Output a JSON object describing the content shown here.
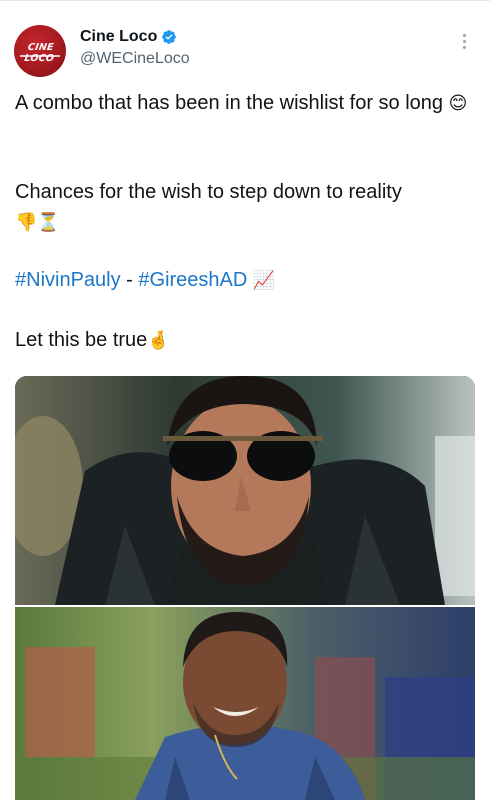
{
  "tweet": {
    "display_name": "Cine Loco",
    "handle": "@WECineLoco",
    "avatar_text": "CINE LOCO",
    "line1": "A combo that has been in the wishlist for so long",
    "line1_emoji": "😊",
    "line2": "Chances for the wish to step down to reality",
    "line2_emojis": "👎⏳",
    "hashtag1": "#NivinPauly",
    "separator": " - ",
    "hashtag2": "#GireeshAD",
    "hashtag_emoji": "📈",
    "line4": "Let this be true",
    "line4_emoji": "🤞"
  },
  "colors": {
    "hashtag": "#1d77c8",
    "verified_badge": "#1d9bf0",
    "handle": "#536471",
    "avatar": "#a51a20"
  },
  "icons": [
    "verified-badge-icon",
    "more-options-icon"
  ]
}
